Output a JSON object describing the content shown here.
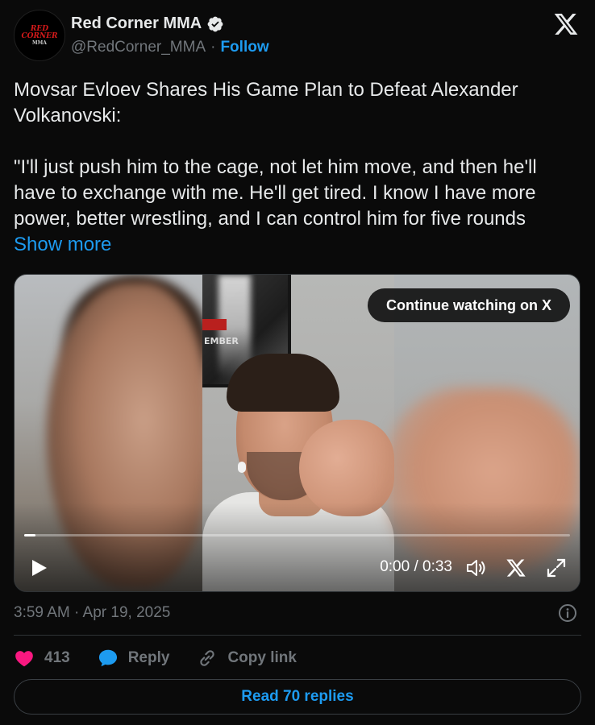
{
  "author": {
    "display_name": "Red Corner MMA",
    "handle": "@RedCorner_MMA",
    "separator": "·",
    "follow_label": "Follow",
    "avatar_logo": {
      "line1": "RED",
      "line2": "CORNER",
      "line3": "MMA"
    }
  },
  "tweet": {
    "text": "Movsar Evloev Shares His Game Plan to Defeat Alexander Volkanovski:\n\n\"I'll just push him to the cage, not let him move, and then he'll have to exchange with me. He'll get tired. I know I have more power, better wrestling, and I can control him for five rounds ",
    "show_more_label": "Show more"
  },
  "video": {
    "continue_label": "Continue watching on X",
    "time_display": "0:00 / 0:33",
    "progress_percent": 2,
    "poster_text": "EMBER"
  },
  "meta": {
    "timestamp": "3:59 AM · Apr 19, 2025"
  },
  "actions": {
    "like_count": "413",
    "reply_label": "Reply",
    "copy_link_label": "Copy link",
    "read_replies_label": "Read 70 replies"
  },
  "colors": {
    "background": "#0a0a0a",
    "accent": "#1d9bf0",
    "like_red": "#f91880",
    "muted": "#71767b"
  },
  "icons": [
    "verified-badge-icon",
    "x-logo-icon",
    "play-icon",
    "volume-icon",
    "x-small-icon",
    "expand-icon",
    "info-icon",
    "heart-icon",
    "reply-bubble-icon",
    "link-icon"
  ]
}
